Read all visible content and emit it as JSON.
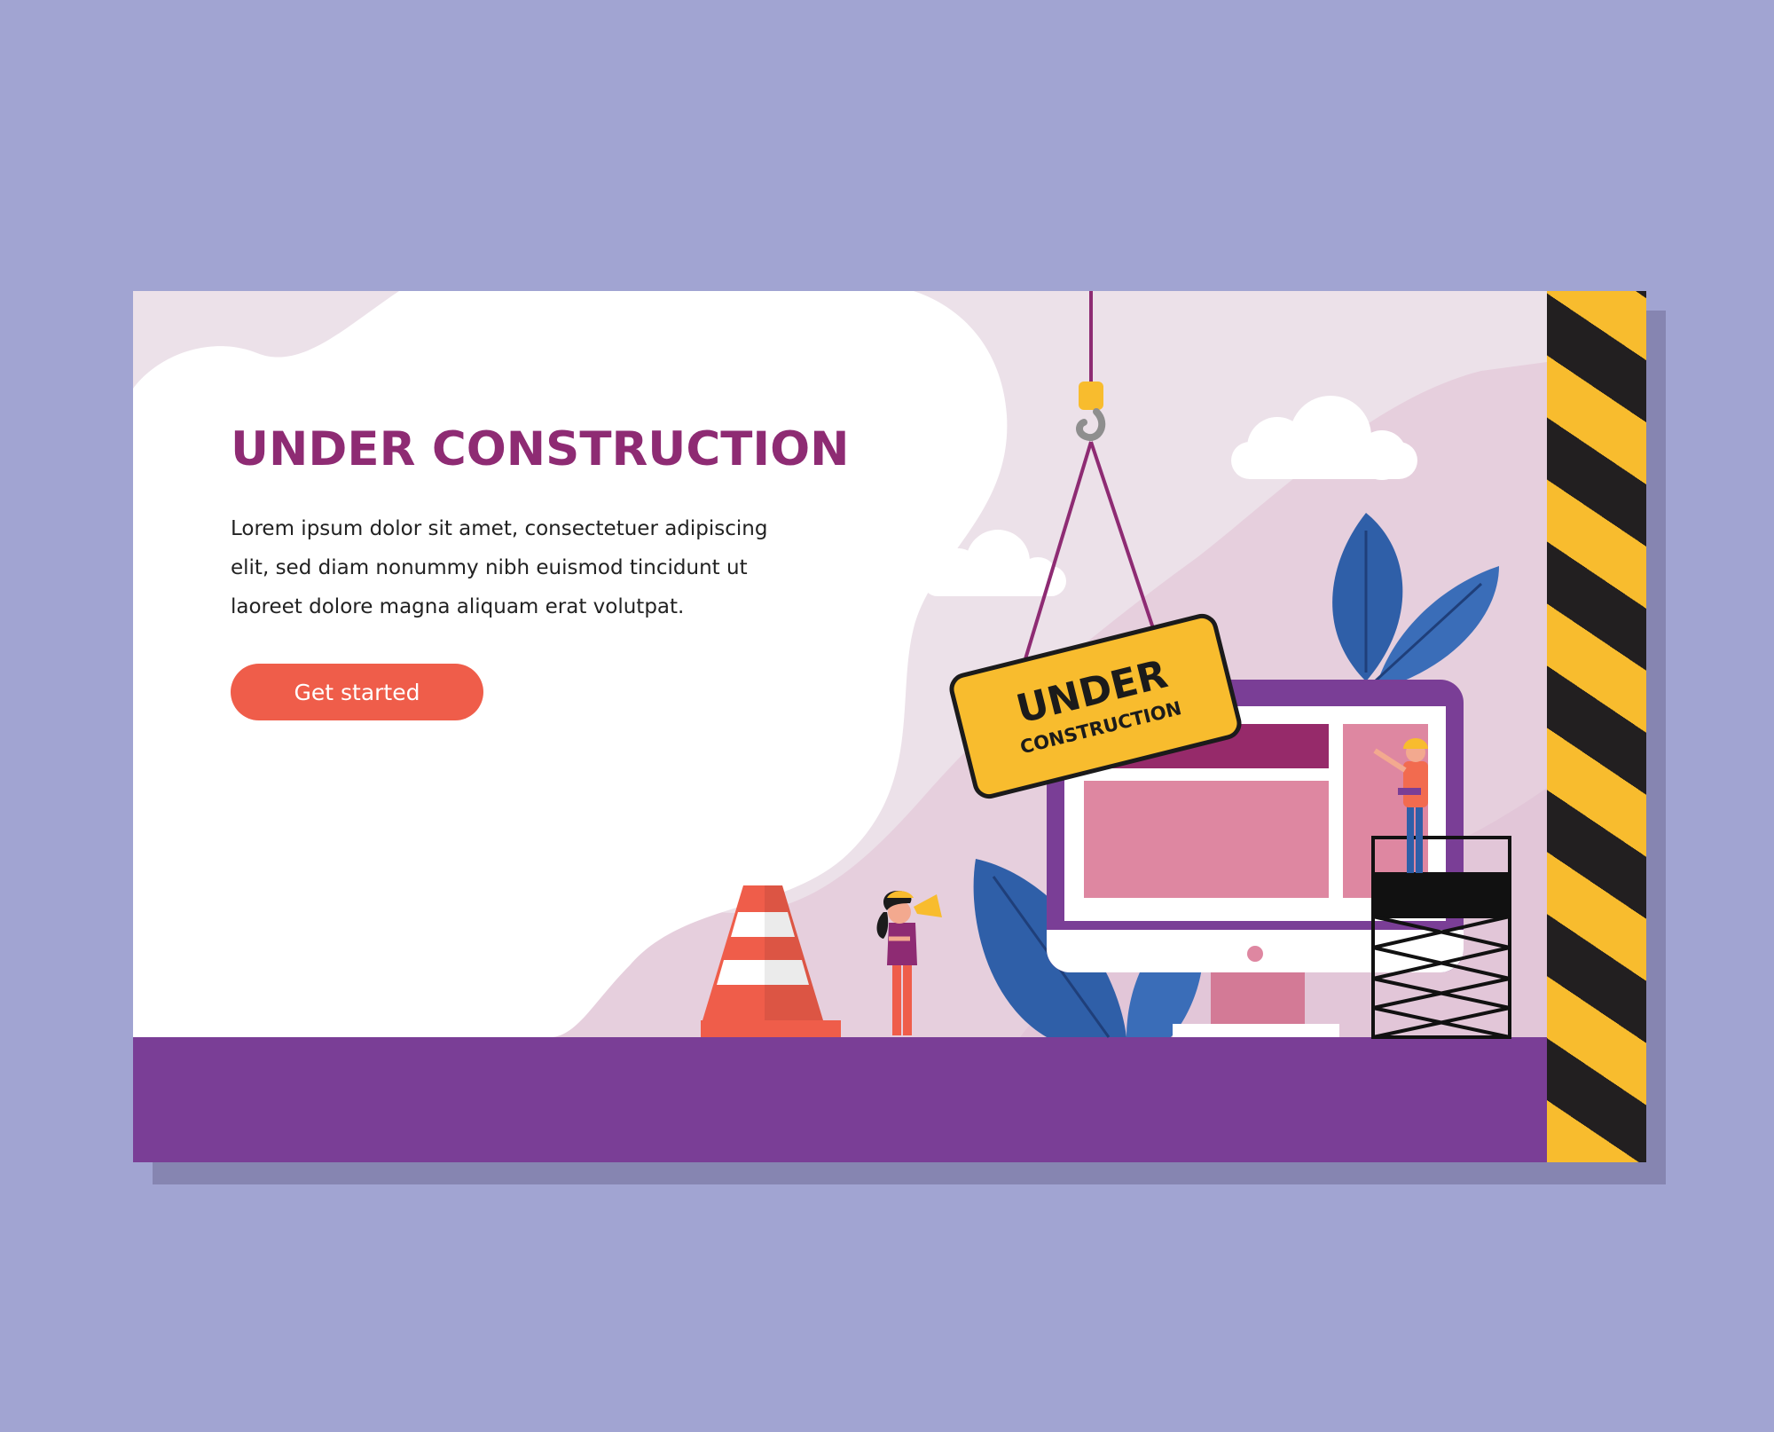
{
  "hero": {
    "title": "UNDER CONSTRUCTION",
    "description": "Lorem ipsum dolor sit amet, consectetuer adipiscing elit, sed diam nonummy nibh euismod tincidunt ut laoreet dolore magna aliquam erat volutpat.",
    "cta_label": "Get started"
  },
  "sign": {
    "line1": "UNDER",
    "line2": "CONSTRUCTION"
  },
  "colors": {
    "page_background": "#a1a4d2",
    "title": "#8e2b73",
    "button": "#ef5d4a",
    "floor": "#7a3e96",
    "hazard_yellow": "#f8bc2e",
    "hazard_black": "#221f20"
  }
}
